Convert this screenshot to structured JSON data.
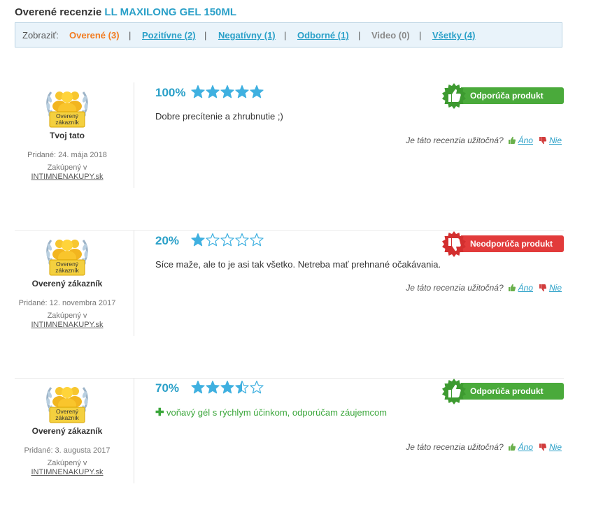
{
  "header": {
    "title_prefix": "Overené recenzie",
    "product_name": "LL MAXILONG GEL 150ML"
  },
  "filter": {
    "label": "Zobraziť:",
    "items": [
      {
        "label": "Overené (3)",
        "state": "active"
      },
      {
        "label": "Pozitívne (2)",
        "state": "link"
      },
      {
        "label": "Negatívny (1)",
        "state": "link"
      },
      {
        "label": "Odborné (1)",
        "state": "link"
      },
      {
        "label": "Video (0)",
        "state": "disabled"
      },
      {
        "label": "Všetky (4)",
        "state": "link"
      }
    ],
    "separator": "|"
  },
  "badge": {
    "line1": "Overený",
    "line2": "zákazník"
  },
  "helpful": {
    "question": "Je táto recenzia užitočná?",
    "yes": "Áno",
    "no": "Nie"
  },
  "colors": {
    "accent_blue": "#2aa0c8",
    "active_orange": "#f27b1f",
    "recommend_green": "#4aaa3b",
    "not_recommend_red": "#e23b3b",
    "star_blue": "#3fb0e0"
  },
  "reviews": [
    {
      "percent": "100%",
      "rating_stars": 5,
      "username": "Tvoj tato",
      "added": "Pridané: 24. mája 2018",
      "bought_label": "Zakúpený v",
      "store": "INTIMNENAKUPY.sk",
      "text": "Dobre precítenie a zhrubnutie ;)",
      "recommend_label": "Odporúča produkt",
      "recommend": true
    },
    {
      "percent": "20%",
      "rating_stars": 1,
      "username": "Overený zákazník",
      "added": "Pridané: 12. novembra 2017",
      "bought_label": "Zakúpený v",
      "store": "INTIMNENAKUPY.sk",
      "text": "Síce maže, ale to je asi tak všetko. Netreba mať prehnané očakávania.",
      "recommend_label": "Neodporúča produkt",
      "recommend": false
    },
    {
      "percent": "70%",
      "rating_stars": 3.5,
      "username": "Overený zákazník",
      "added": "Pridané: 3. augusta 2017",
      "bought_label": "Zakúpený v",
      "store": "INTIMNENAKUPY.sk",
      "pros": "voňavý gél s rýchlym účinkom, odporúčam záujemcom",
      "recommend_label": "Odporúča produkt",
      "recommend": true
    }
  ]
}
